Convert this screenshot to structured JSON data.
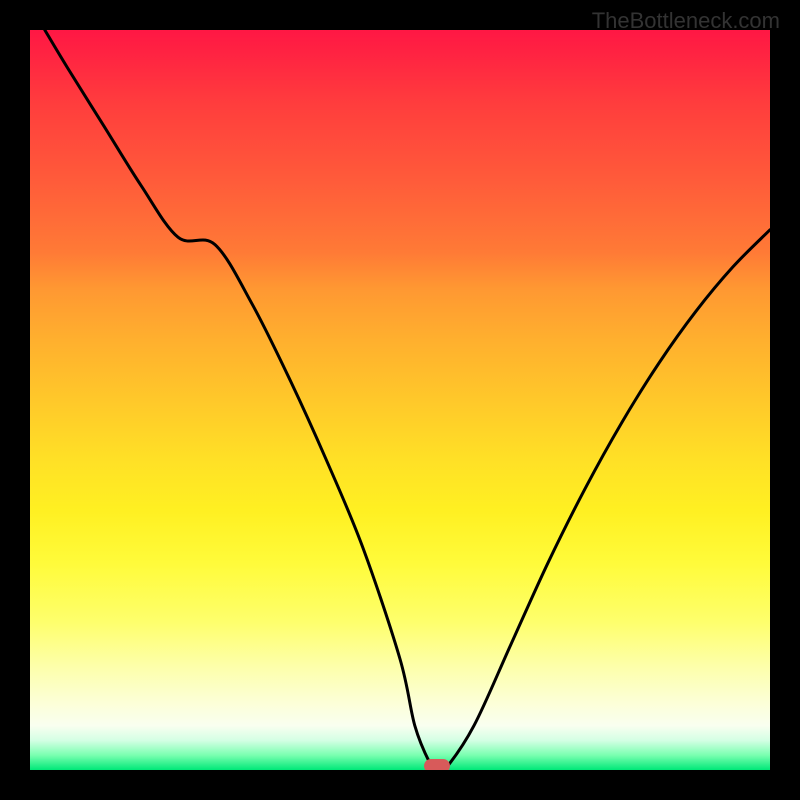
{
  "attribution": "TheBottleneck.com",
  "chart_data": {
    "type": "line",
    "title": "",
    "xlabel": "",
    "ylabel": "",
    "xlim": [
      0,
      100
    ],
    "ylim": [
      0,
      100
    ],
    "x": [
      2,
      5,
      10,
      15,
      20,
      25,
      30,
      35,
      40,
      45,
      50,
      52,
      54,
      55,
      56,
      60,
      65,
      70,
      75,
      80,
      85,
      90,
      95,
      100
    ],
    "values": [
      100,
      95,
      87,
      79,
      72,
      71,
      63,
      53,
      42,
      30,
      15,
      6,
      1,
      0,
      0,
      6,
      17,
      28,
      38,
      47,
      55,
      62,
      68,
      73
    ],
    "minimum_x": 55,
    "minimum_y": 0,
    "marker": {
      "x_pct": 55,
      "y_pct": 0
    }
  },
  "colors": {
    "curve": "#000000",
    "marker": "#d85a5a",
    "background_top": "#ff1744",
    "background_bottom": "#00e878"
  }
}
